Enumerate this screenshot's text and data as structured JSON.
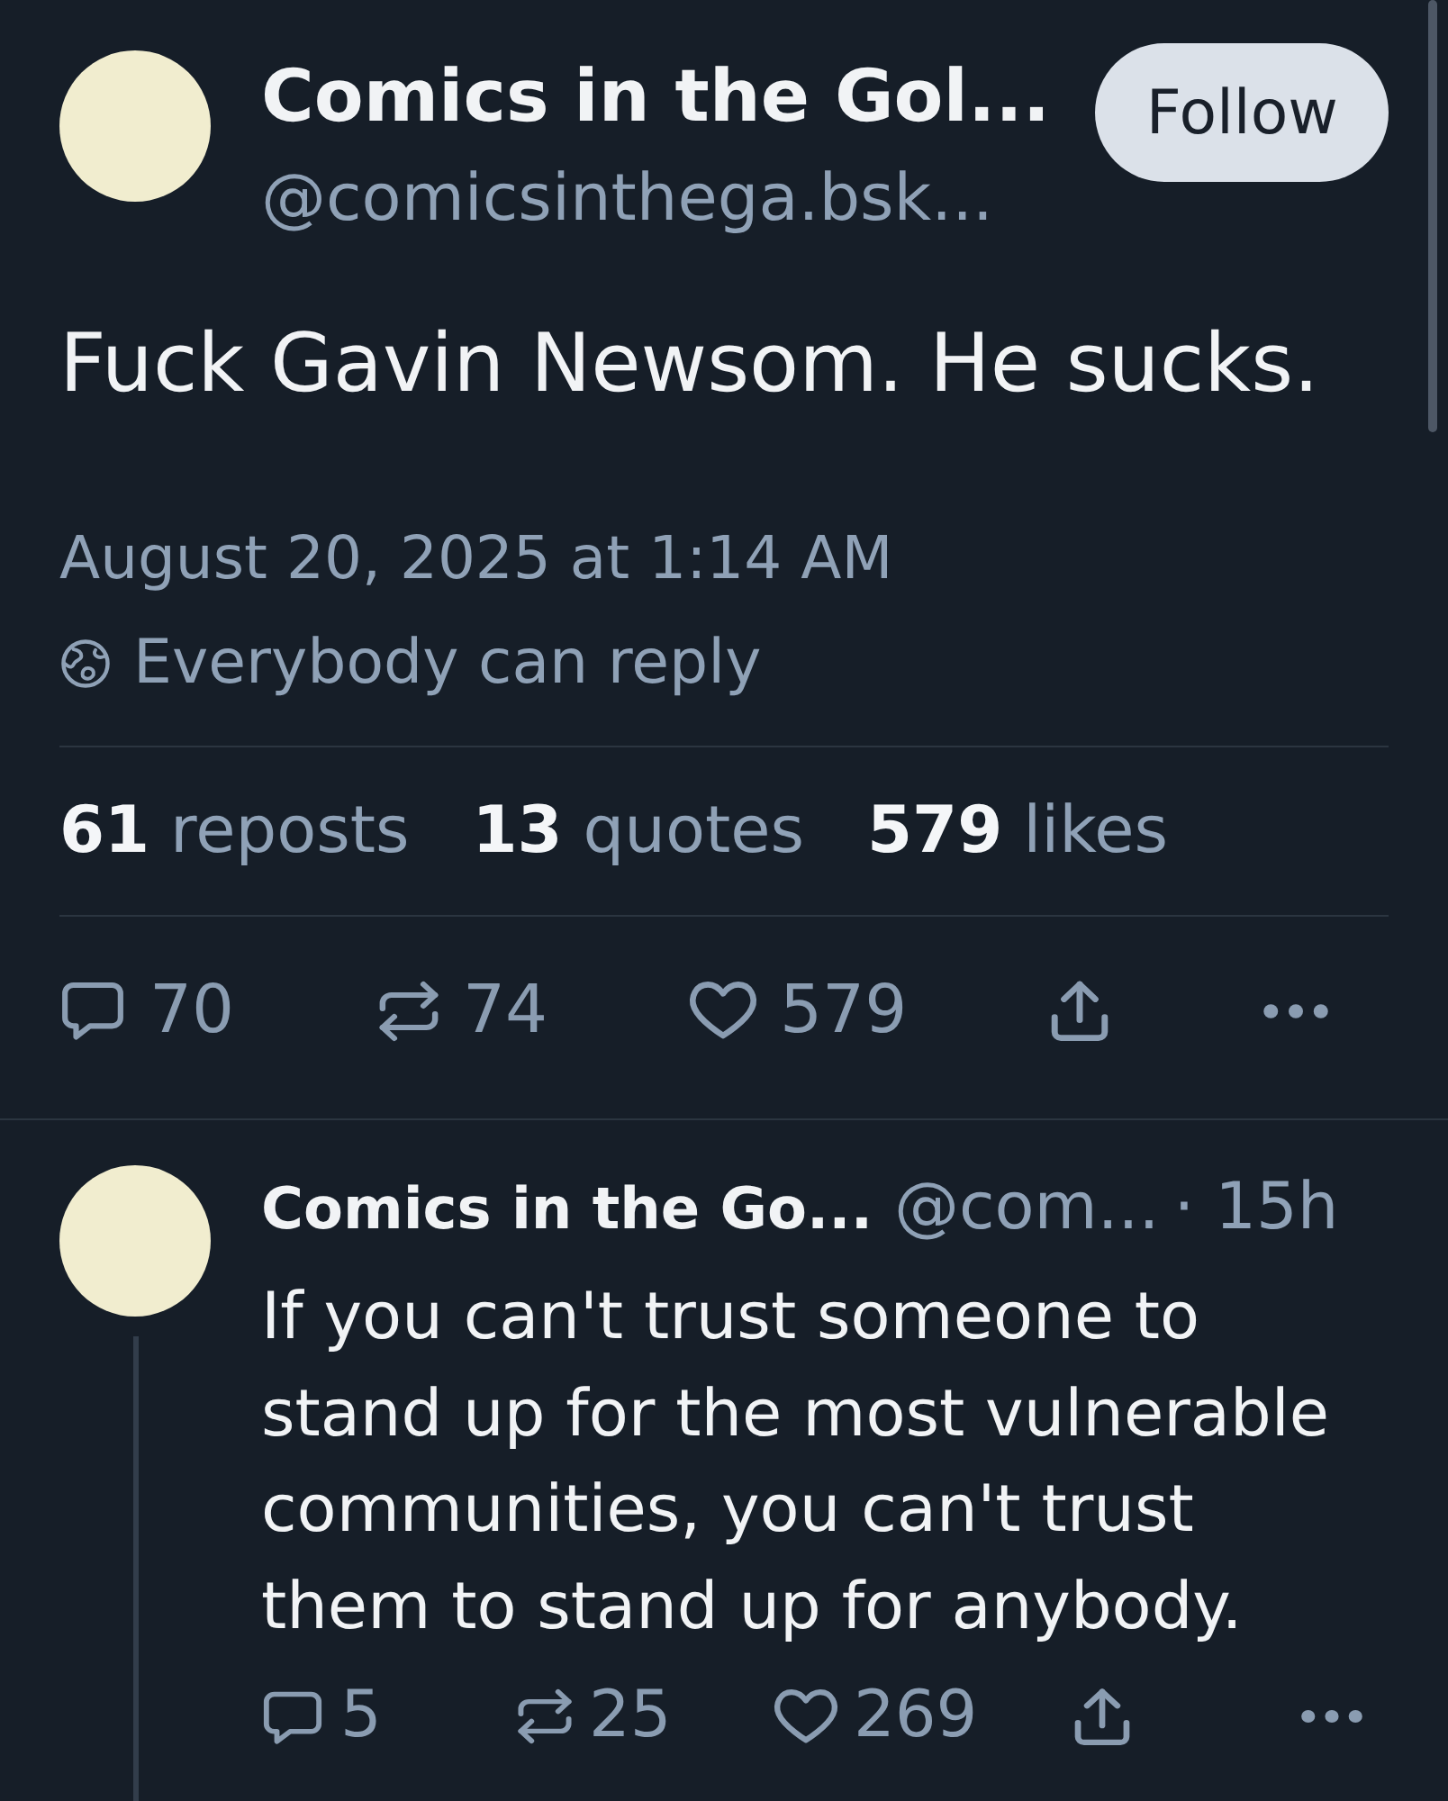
{
  "post": {
    "author": {
      "name": "Comics in the Gol...",
      "handle": "@comicsinthega.bsk..."
    },
    "follow_button": "Follow",
    "text": "Fuck Gavin Newsom. He sucks.",
    "timestamp": "August 20, 2025 at 1:14 AM",
    "reply_setting": "Everybody can reply",
    "stats": [
      {
        "count": "61",
        "label": "reposts"
      },
      {
        "count": "13",
        "label": "quotes"
      },
      {
        "count": "579",
        "label": "likes"
      }
    ],
    "actions": [
      {
        "kind": "reply",
        "count": "70"
      },
      {
        "kind": "repost",
        "count": "74"
      },
      {
        "kind": "like",
        "count": "579"
      },
      {
        "kind": "share"
      },
      {
        "kind": "more"
      }
    ]
  },
  "replies": [
    {
      "author": {
        "name": "Comics in the Go...",
        "handle": "@com..."
      },
      "time": "· 15h",
      "text": "If you can't trust someone to stand up for the most vulnerable communities, you can't trust them to stand up for anybody.",
      "actions": [
        {
          "kind": "reply",
          "count": "5"
        },
        {
          "kind": "repost",
          "count": "25"
        },
        {
          "kind": "like",
          "count": "269"
        },
        {
          "kind": "share"
        },
        {
          "kind": "more"
        }
      ]
    }
  ]
}
